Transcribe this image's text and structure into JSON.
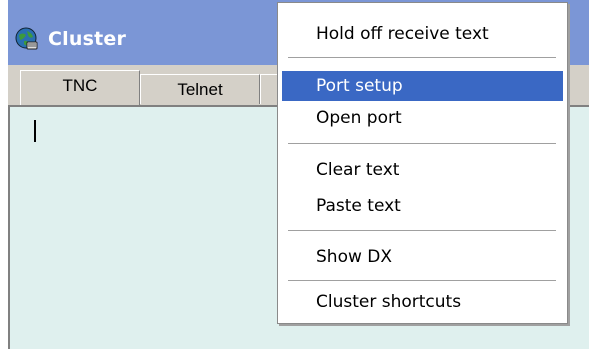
{
  "window": {
    "title": "Cluster",
    "icon": "globe-app-icon"
  },
  "tabs": [
    {
      "label": "TNC"
    },
    {
      "label": "Telnet"
    }
  ],
  "menu": {
    "items": [
      {
        "label": "Hold off receive text"
      },
      {
        "label": "Port setup",
        "highlighted": true
      },
      {
        "label": "Open port"
      },
      {
        "label": "Clear text"
      },
      {
        "label": "Paste text"
      },
      {
        "label": "Show DX"
      },
      {
        "label": "Cluster shortcuts"
      }
    ]
  },
  "colors": {
    "titlebar": "#7b96d6",
    "content_bg": "#dff0ee",
    "menu_highlight": "#3a68c4"
  }
}
